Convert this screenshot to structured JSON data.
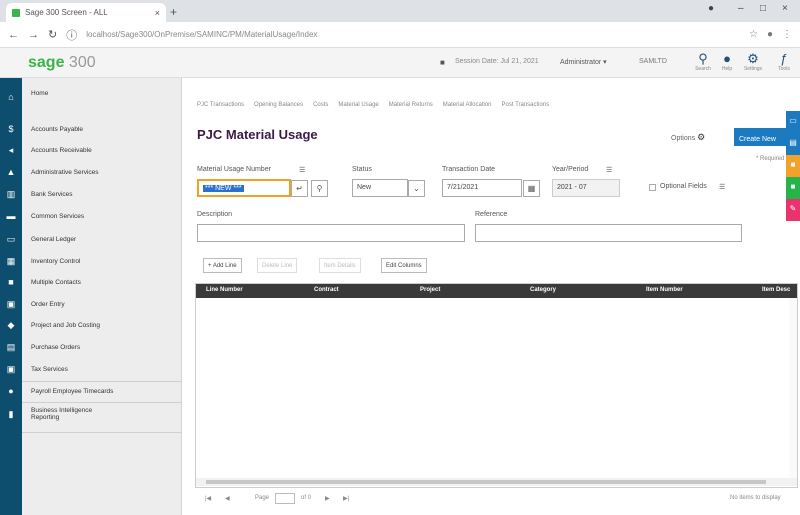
{
  "browser": {
    "tab_title": "Sage 300 Screen - ALL",
    "tab_close": "×",
    "new_tab": "+",
    "url": "localhost/Sage300/OnPremise/SAMINC/PM/MaterialUsage/Index",
    "minimize": "–",
    "maximize": "□",
    "close": "×"
  },
  "app": {
    "logo_sage": "sage",
    "logo_num": "300",
    "session_date": "Session Date: Jul 21, 2021",
    "user": "Administrator ▾",
    "company": "SAMLTD",
    "search_label": "Search",
    "help_label": "Help",
    "settings_label": "Settings",
    "tools_label": "Tools"
  },
  "sidebar": {
    "items": [
      {
        "label": "Home"
      },
      {
        "label": "Accounts Payable"
      },
      {
        "label": "Accounts Receivable"
      },
      {
        "label": "Administrative Services"
      },
      {
        "label": "Bank Services"
      },
      {
        "label": "Common Services"
      },
      {
        "label": "General Ledger"
      },
      {
        "label": "Inventory Control"
      },
      {
        "label": "Multiple Contacts"
      },
      {
        "label": "Order Entry"
      },
      {
        "label": "Project and Job Costing"
      },
      {
        "label": "Purchase Orders"
      },
      {
        "label": "Tax Services"
      },
      {
        "label": "Payroll Employee Timecards"
      },
      {
        "label": "Business Intelligence Reporting"
      }
    ]
  },
  "main": {
    "breadcrumbs": [
      "PJC Transactions",
      "Opening Balances",
      "Costs",
      "Material Usage",
      "Material Returns",
      "Material Allocation",
      "Post Transactions"
    ],
    "title": "PJC Material Usage",
    "options_label": "Options",
    "create_button": "Create New",
    "required_note": "* Required",
    "fields": {
      "material_usage_number_label": "Material Usage Number",
      "material_usage_number_value": "*** NEW ***",
      "status_label": "Status",
      "status_value": "New",
      "transaction_date_label": "Transaction Date",
      "transaction_date_value": "7/21/2021",
      "year_period_label": "Year/Period",
      "year_value": "2021",
      "period_separator": "-",
      "period_value": "07",
      "optional_fields_label": "Optional Fields",
      "description_label": "Description",
      "description_value": "",
      "reference_label": "Reference",
      "reference_value": ""
    },
    "toolbar": {
      "add_line": "+ Add Line",
      "delete_line": "Delete Line",
      "item_details": "Item Details",
      "edit_columns": "Edit Columns"
    },
    "grid": {
      "columns": [
        "Line Number",
        "Contract",
        "Project",
        "Category",
        "Item Number",
        "Item Desc"
      ]
    },
    "pager": {
      "first": "|◀",
      "prev": "◀",
      "page_label": "Page",
      "of_label": "of 0",
      "next": "▶",
      "last": "▶|",
      "no_items": "No items to display"
    }
  },
  "colors": {
    "sidebar_icons_bg": "#0d4d6e",
    "brand_green": "#3bb44a",
    "primary_button": "#1c7bc0",
    "title": "#3b1a4a",
    "rail": [
      "#1c7bc0",
      "#1c7bc0",
      "#f2a22a",
      "#26b34a",
      "#e8336e"
    ]
  }
}
